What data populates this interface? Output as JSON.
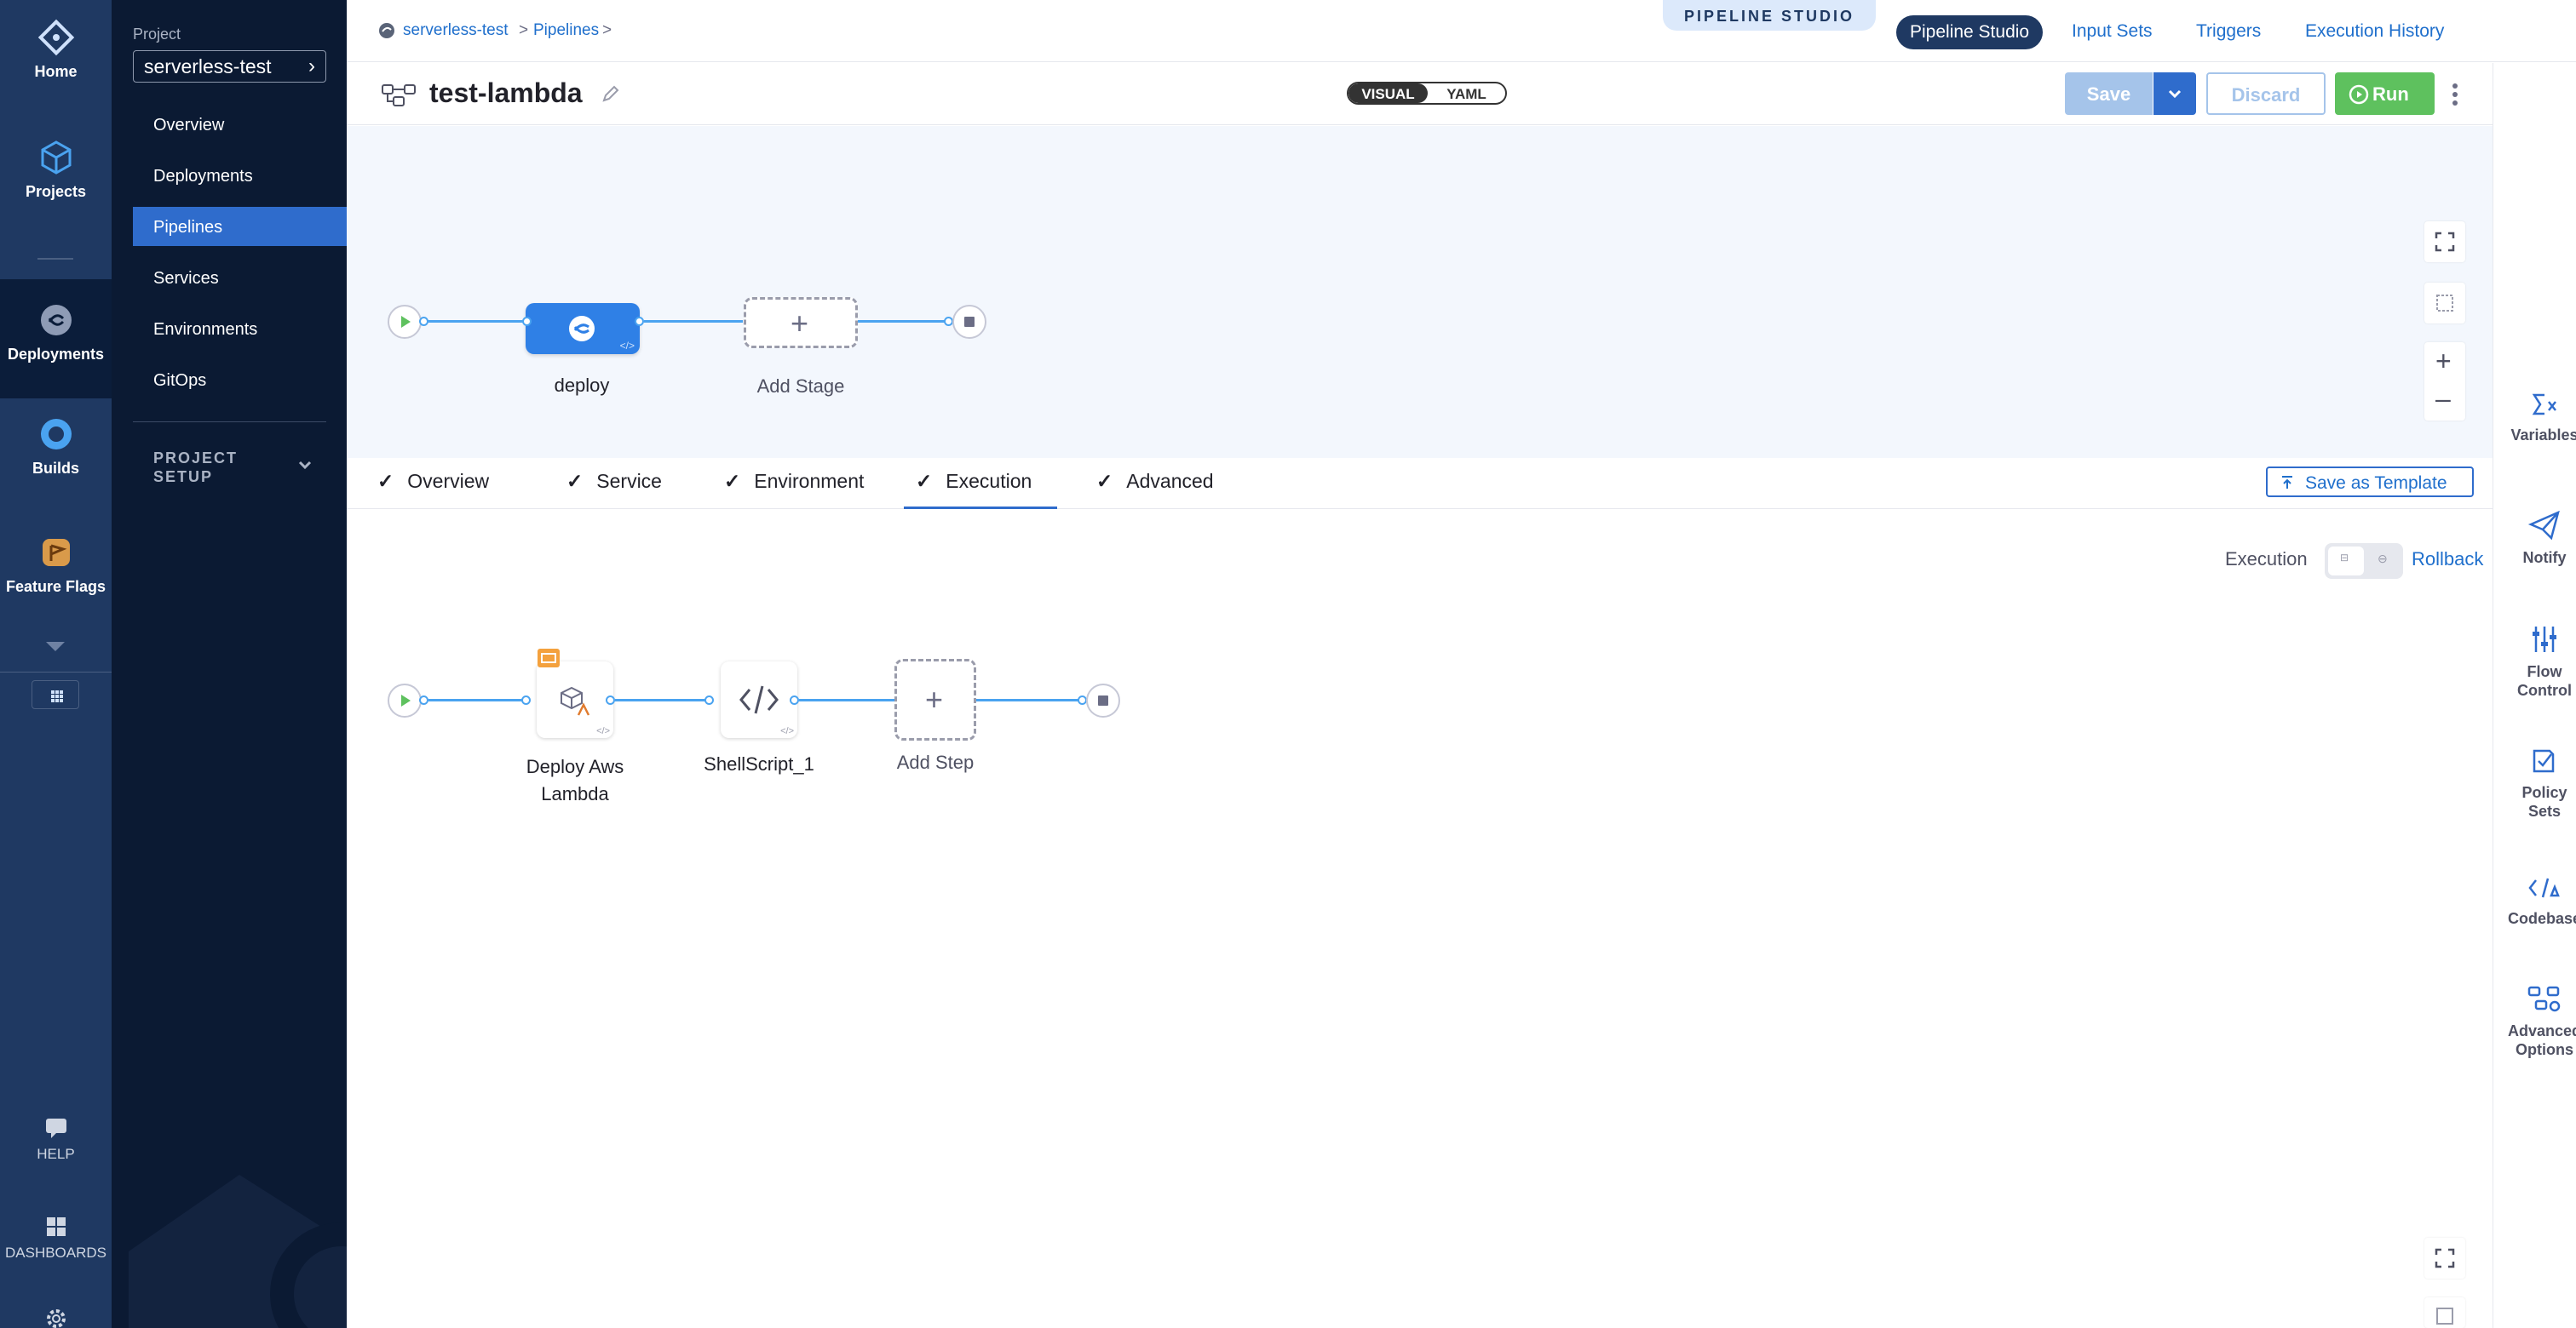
{
  "leftnav": {
    "items": [
      {
        "label": "Home",
        "icon": "harness-logo-icon"
      },
      {
        "label": "Projects",
        "icon": "cube-icon"
      },
      {
        "label": "Deployments",
        "icon": "deployments-icon"
      },
      {
        "label": "Builds",
        "icon": "builds-icon"
      },
      {
        "label": "Feature Flags",
        "icon": "feature-flags-icon"
      }
    ],
    "help": "HELP",
    "dashboards": "DASHBOARDS"
  },
  "project_nav": {
    "project_label": "Project",
    "project_name": "serverless-test",
    "items": [
      "Overview",
      "Deployments",
      "Pipelines",
      "Services",
      "Environments",
      "GitOps"
    ],
    "active_item": "Pipelines",
    "project_setup": "PROJECT SETUP"
  },
  "header": {
    "breadcrumb": [
      "serverless-test",
      "Pipelines"
    ],
    "studio_badge": "PIPELINE STUDIO",
    "tabs": [
      "Pipeline Studio",
      "Input Sets",
      "Triggers",
      "Execution History"
    ],
    "active_tab": "Pipeline Studio"
  },
  "subheader": {
    "pipeline_name": "test-lambda",
    "view_toggle": {
      "visual": "VISUAL",
      "yaml": "YAML",
      "selected": "VISUAL"
    },
    "save": "Save",
    "discard": "Discard",
    "run": "Run"
  },
  "stage_canvas": {
    "stages": [
      {
        "name": "deploy"
      }
    ],
    "add_stage": "Add Stage"
  },
  "stage_tabs": {
    "tabs": [
      "Overview",
      "Service",
      "Environment",
      "Execution",
      "Advanced"
    ],
    "active": "Execution",
    "save_template": "Save as Template"
  },
  "execution": {
    "toggle_label": "Execution",
    "rollback_label": "Rollback",
    "steps": [
      {
        "name": "Deploy Aws Lambda",
        "name_line1": "Deploy Aws",
        "name_line2": "Lambda"
      },
      {
        "name": "ShellScript_1"
      }
    ],
    "add_step": "Add Step"
  },
  "right_panel": {
    "items": [
      {
        "label": "Variables",
        "icon": "variables-icon"
      },
      {
        "label": "Notify",
        "icon": "notify-icon"
      },
      {
        "label1": "Flow",
        "label2": "Control",
        "icon": "flow-control-icon"
      },
      {
        "label1": "Policy",
        "label2": "Sets",
        "icon": "policy-sets-icon"
      },
      {
        "label": "Codebase",
        "icon": "codebase-icon"
      },
      {
        "label1": "Advanced",
        "label2": "Options",
        "icon": "advanced-options-icon"
      }
    ]
  },
  "colors": {
    "nav_bg": "#1f3962",
    "project_nav_bg": "#0b1a33",
    "accent_blue": "#2f6ccc",
    "link_blue": "#1f6fcc",
    "run_green": "#5ec15e",
    "canvas_bg": "#f3f7fd"
  }
}
